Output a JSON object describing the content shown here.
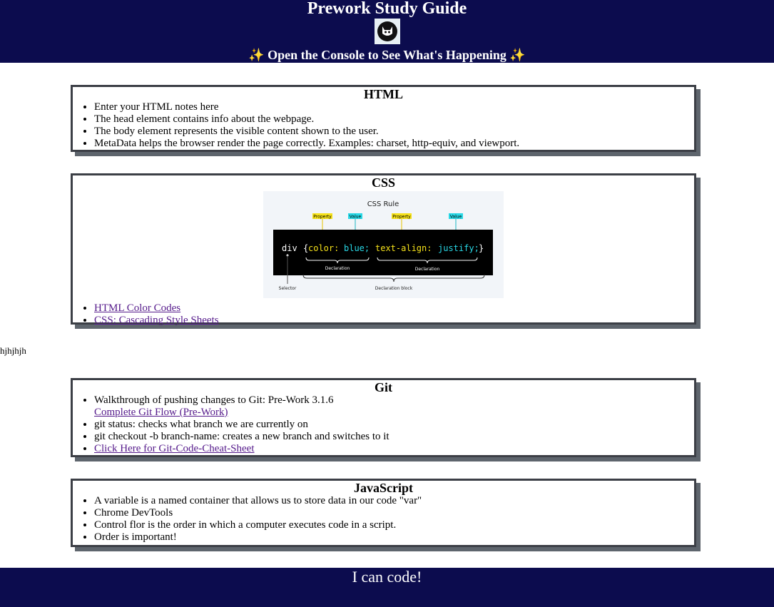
{
  "header": {
    "title": "Prework Study Guide",
    "banner": {
      "left_icon": "sparkles",
      "text": "Open the Console to See What's Happening",
      "right_icon": "sparkles"
    },
    "logo": "cat-logo"
  },
  "colors": {
    "header_bg": "#0c0c4e",
    "card_border": "#3c3f46",
    "card_shadow": "#5e656d",
    "link": "#551a8b"
  },
  "sections": {
    "html": {
      "heading": "HTML",
      "items": [
        "Enter your HTML notes here",
        "The head element contains info about the webpage.",
        "The body element represents the visible content shown to the user.",
        "MetaData helps the browser render the page correctly. Examples: charset, http-equiv, and viewport."
      ]
    },
    "css": {
      "heading": "CSS",
      "figure": {
        "title": "CSS Rule",
        "property_tag": "Property",
        "value_tag": "Value",
        "code_selector": "div",
        "code_open": "{",
        "code_prop1": "color:",
        "code_val1": "blue;",
        "code_prop2": "text-align:",
        "code_val2": "justify;",
        "code_close": "}",
        "declaration": "Declaration",
        "selector": "Selector",
        "declaration_block": "Declaration block"
      },
      "links": [
        "HTML Color Codes",
        "CSS: Cascading Style Sheets"
      ]
    },
    "stray_text": "hjhjhjh",
    "git": {
      "heading": "Git",
      "item1": "Walkthrough of pushing changes to Git: Pre-Work 3.1.6",
      "item1_link": "Complete Git Flow (Pre-Work)",
      "item2": "git status: checks what branch we are currently on",
      "item3": "git checkout -b branch-name: creates a new branch and switches to it",
      "item4_link": "Click Here for Git-Code-Cheat-Sheet"
    },
    "javascript": {
      "heading": "JavaScript",
      "items": [
        "A variable is a named container that allows us to store data in our code \"var\"",
        "Chrome DevTools",
        "Control flor is the order in which a computer executes code in a script.",
        "Order is important!"
      ]
    }
  },
  "footer": {
    "text": "I can code!"
  }
}
